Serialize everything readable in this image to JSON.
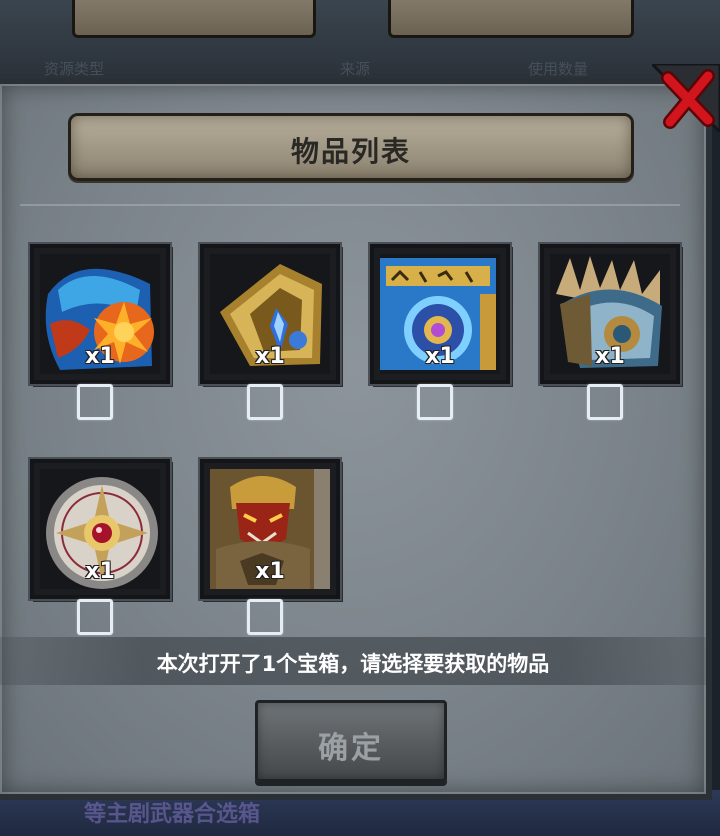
{
  "background": {
    "columns": [
      "资源类型",
      "来源",
      "使用数量"
    ],
    "bottom_text": "等主剧武器合选箱"
  },
  "dialog": {
    "title": "物品列表",
    "hint": "本次打开了1个宝箱，请选择要获取的物品",
    "confirm_label": "确定"
  },
  "items": [
    {
      "name": "flame-sun-shield",
      "qty": "x1",
      "checked": false
    },
    {
      "name": "golden-crystal-armor",
      "qty": "x1",
      "checked": false
    },
    {
      "name": "blue-rune-tome",
      "qty": "x1",
      "checked": false
    },
    {
      "name": "winged-shoulder-guard",
      "qty": "x1",
      "checked": false
    },
    {
      "name": "eye-rune-shield",
      "qty": "x1",
      "checked": false
    },
    {
      "name": "demon-knight-card",
      "qty": "x1",
      "checked": false
    }
  ],
  "colors": {
    "close": "#c8141a",
    "panel": "#7b848a",
    "title_plaque": "#a59c8a"
  }
}
